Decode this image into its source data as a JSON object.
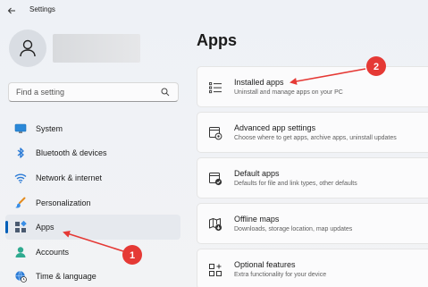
{
  "app": {
    "title": "Settings"
  },
  "search": {
    "placeholder": "Find a setting"
  },
  "sidebar": {
    "items": [
      {
        "label": "System",
        "icon": "monitor-icon"
      },
      {
        "label": "Bluetooth & devices",
        "icon": "bluetooth-icon"
      },
      {
        "label": "Network & internet",
        "icon": "wifi-icon"
      },
      {
        "label": "Personalization",
        "icon": "paintbrush-icon"
      },
      {
        "label": "Apps",
        "icon": "apps-icon",
        "active": true
      },
      {
        "label": "Accounts",
        "icon": "person-icon"
      },
      {
        "label": "Time & language",
        "icon": "globe-clock-icon"
      }
    ]
  },
  "main": {
    "title": "Apps",
    "cards": [
      {
        "title": "Installed apps",
        "subtitle": "Uninstall and manage apps on your PC",
        "icon": "list-icon"
      },
      {
        "title": "Advanced app settings",
        "subtitle": "Choose where to get apps, archive apps, uninstall updates",
        "icon": "app-settings-icon"
      },
      {
        "title": "Default apps",
        "subtitle": "Defaults for file and link types, other defaults",
        "icon": "default-apps-icon"
      },
      {
        "title": "Offline maps",
        "subtitle": "Downloads, storage location, map updates",
        "icon": "map-icon"
      },
      {
        "title": "Optional features",
        "subtitle": "Extra functionality for your device",
        "icon": "optional-features-icon"
      }
    ]
  },
  "annotations": [
    {
      "number": "1",
      "color": "#e53935"
    },
    {
      "number": "2",
      "color": "#e53935"
    }
  ],
  "colors": {
    "accent": "#005fb8",
    "annotation": "#e53935"
  }
}
